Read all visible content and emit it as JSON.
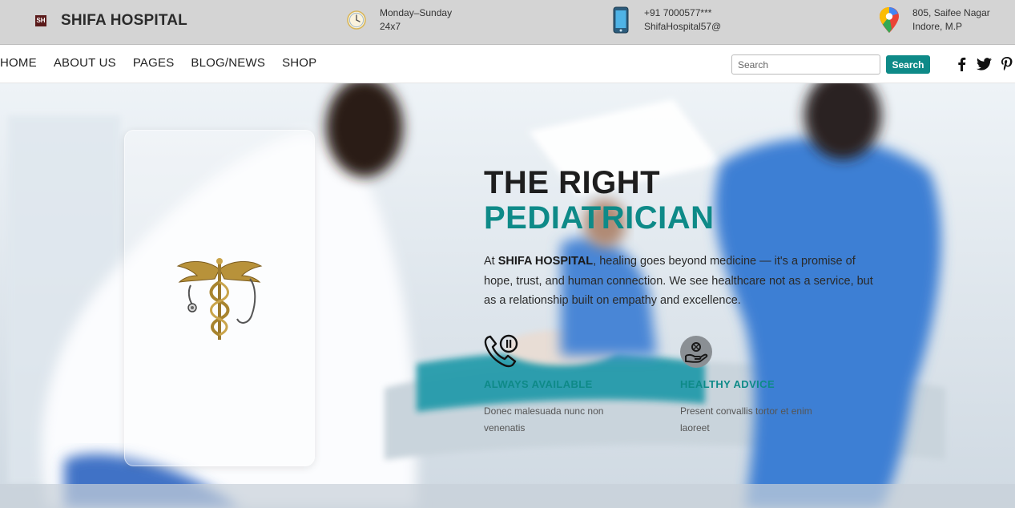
{
  "header": {
    "logo_badge": "SH",
    "brand": "SHIFA HOSPITAL",
    "hours": {
      "line1": "Monday–Sunday",
      "line2": "24x7",
      "icon": "clock-icon"
    },
    "contact": {
      "line1": "+91 7000577***",
      "line2": "ShifaHospital57@",
      "icon": "phone-icon"
    },
    "address": {
      "line1": "805, Saifee Nagar",
      "line2": "Indore, M.P",
      "icon": "map-pin-icon"
    }
  },
  "nav": {
    "links": [
      "HOME",
      "ABOUT US",
      "PAGES",
      "BLOG/NEWS",
      "SHOP"
    ],
    "search_placeholder": "Search",
    "search_button": "Search",
    "social": [
      "facebook-icon",
      "twitter-icon",
      "pinterest-icon"
    ]
  },
  "hero": {
    "title_line1": "THE RIGHT",
    "title_line2": "PEDIATRICIAN",
    "text_prefix": "At ",
    "text_brand": "SHIFA HOSPITAL",
    "text_body": ", healing goes beyond medicine — it's a promise of hope, trust, and human connection. We see healthcare not as a service, but as a relationship built on empathy and excellence.",
    "features": [
      {
        "title": "ALWAYS AVAILABLE",
        "desc": "Donec malesuada nunc non venenatis",
        "icon": "phone-call-icon"
      },
      {
        "title": "HEALTHY ADVICE",
        "desc": "Present convallis tortor et enim laoreet",
        "icon": "hand-advice-icon"
      }
    ]
  },
  "colors": {
    "accent": "#0e8a88",
    "topbar": "#d4d4d4",
    "logo_badge": "#5a1a1a"
  }
}
